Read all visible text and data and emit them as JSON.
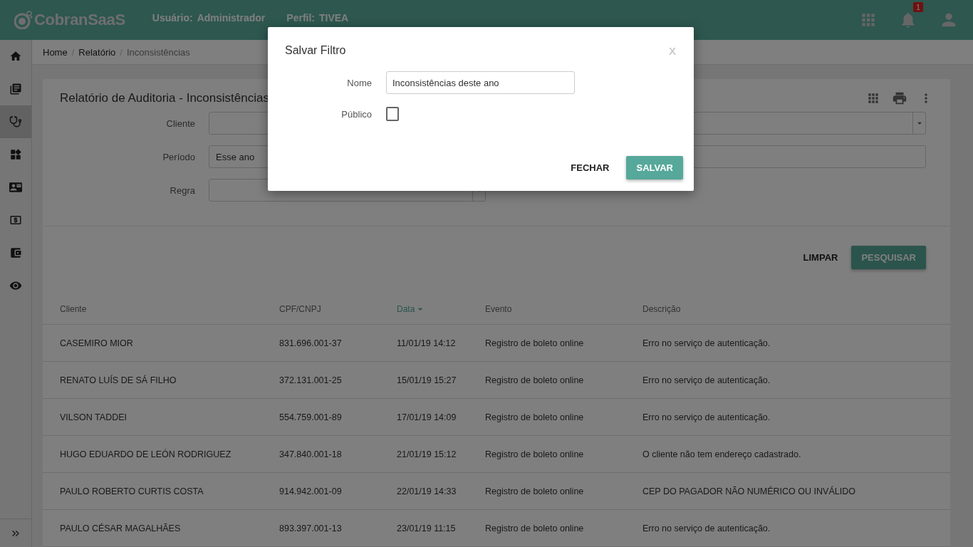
{
  "header": {
    "brand": "CobranSaaS",
    "user_label": "Usuário:",
    "user_value": "Administrador",
    "profile_label": "Perfil:",
    "profile_value": "TIVEA",
    "notification_count": "1"
  },
  "sidebar": {
    "items": [
      {
        "selected": false
      },
      {
        "selected": false
      },
      {
        "selected": true
      },
      {
        "selected": false
      },
      {
        "selected": false
      },
      {
        "selected": false
      },
      {
        "selected": false
      },
      {
        "selected": false
      }
    ]
  },
  "breadcrumb": [
    {
      "label": "Home",
      "current": false
    },
    {
      "separator": "/",
      "label": "Relatório",
      "current": false
    },
    {
      "separator": "/",
      "label": "Inconsistências",
      "current": true
    }
  ],
  "report": {
    "title": "Relatório de Auditoria - Inconsistências",
    "filters": [
      {
        "label": "Cliente",
        "kind": "select",
        "wide": true
      },
      {
        "label": "Período",
        "kind": "input",
        "value": "Esse ano",
        "wide": true
      },
      {
        "label": "Regra",
        "kind": "select",
        "wide": false
      }
    ],
    "actions": {
      "clear": "LIMPAR",
      "search": "PESQUISAR"
    },
    "columns": [
      {
        "label": "Cliente",
        "sorted": false
      },
      {
        "label": "CPF/CNPJ",
        "sorted": false
      },
      {
        "label": "Data",
        "sorted": true
      },
      {
        "label": "Evento",
        "sorted": false
      },
      {
        "label": "Descrição",
        "sorted": false
      }
    ],
    "rows": [
      [
        "CASEMIRO MIOR",
        "831.696.001-37",
        "11/01/19 14:12",
        "Registro de boleto online",
        "Erro no serviço de autenticação."
      ],
      [
        "RENATO LUÍS DE SÁ FILHO",
        "372.131.001-25",
        "15/01/19 15:27",
        "Registro de boleto online",
        "Erro no serviço de autenticação."
      ],
      [
        "VILSON TADDEI",
        "554.759.001-89",
        "17/01/19 14:09",
        "Registro de boleto online",
        "Erro no serviço de autenticação."
      ],
      [
        "HUGO EDUARDO DE LEÓN RODRIGUEZ",
        "347.840.001-18",
        "21/01/19 15:12",
        "Registro de boleto online",
        "O cliente não tem endereço cadastrado."
      ],
      [
        "PAULO ROBERTO CURTIS COSTA",
        "914.942.001-09",
        "22/01/19 14:33",
        "Registro de boleto online",
        "CEP DO PAGADOR NÃO NUMÉRICO OU INVÁLIDO"
      ],
      [
        "PAULO CÉSAR MAGALHÃES",
        "893.397.001-13",
        "23/01/19 11:15",
        "Registro de boleto online",
        "Erro no serviço de autenticação."
      ]
    ]
  },
  "dialog": {
    "title": "Salvar Filtro",
    "close": "X",
    "name_label": "Nome",
    "name_value": "Inconsistências deste ano",
    "public_label": "Público",
    "public_checked": false,
    "cancel": "FECHAR",
    "save": "SALVAR"
  }
}
